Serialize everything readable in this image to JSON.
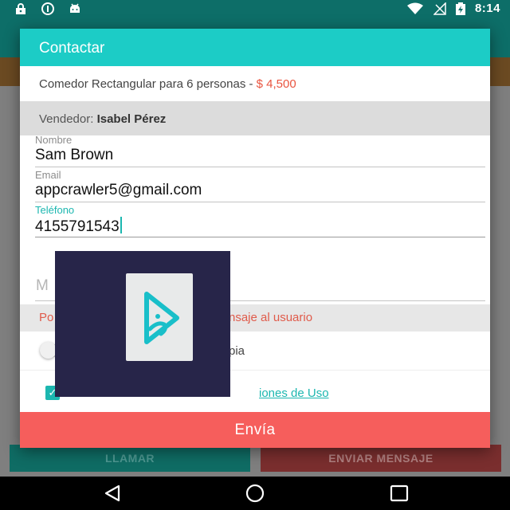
{
  "status_bar": {
    "time": "8:14",
    "icons": [
      "lock-icon",
      "sync-icon",
      "android-icon",
      "wifi-icon",
      "no-signal-icon",
      "battery-charging-icon"
    ]
  },
  "background_app": {
    "call_label": "LLAMAR",
    "message_label": "ENVIAR MENSAJE"
  },
  "dialog": {
    "title": "Contactar",
    "product_name": "Comedor Rectangular para 6 personas - ",
    "product_price": "$ 4,500",
    "seller_prefix": "Vendedor: ",
    "seller_name": "Isabel Pérez",
    "fields": {
      "name": {
        "label": "Nombre",
        "value": "Sam Brown"
      },
      "email": {
        "label": "Email",
        "value": "appcrawler5@gmail.com"
      },
      "phone": {
        "label": "Teléfono",
        "value": "4155791543"
      },
      "message": {
        "placeholder": "M"
      }
    },
    "warning_text_left": "Po",
    "warning_text_right": "nsaje al usuario",
    "copy_toggle_label": "pia",
    "terms_link": "iones de Uso",
    "terms_checked": true,
    "send_label": "Envía"
  },
  "colors": {
    "accent": "#1cccc6",
    "send": "#f65e5c",
    "price": "#e9543f",
    "overlay": "#272549"
  }
}
